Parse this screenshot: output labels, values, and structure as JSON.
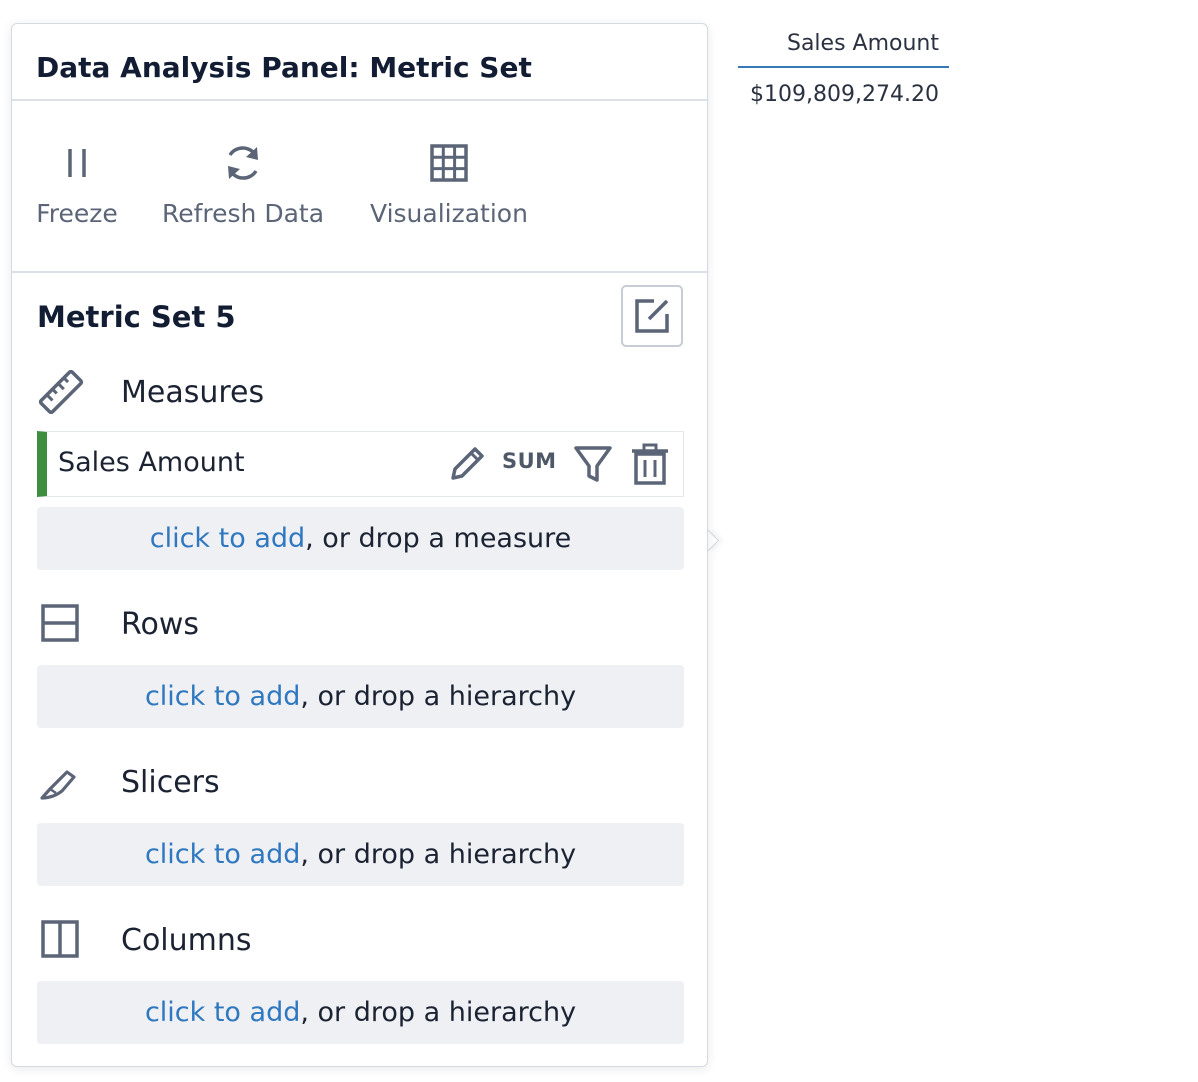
{
  "panel": {
    "title": "Data Analysis Panel: Metric Set"
  },
  "toolbar": {
    "freeze_label": "Freeze",
    "refresh_label": "Refresh Data",
    "visualization_label": "Visualization"
  },
  "metric_set": {
    "title": "Metric Set 5"
  },
  "sections": {
    "measures": {
      "title": "Measures",
      "items": [
        {
          "name": "Sales Amount",
          "aggregation": "SUM"
        }
      ],
      "drop_link": "click to add",
      "drop_text": ", or drop a measure"
    },
    "rows": {
      "title": "Rows",
      "drop_link": "click to add",
      "drop_text": ", or drop a hierarchy"
    },
    "slicers": {
      "title": "Slicers",
      "drop_link": "click to add",
      "drop_text": ", or drop a hierarchy"
    },
    "columns": {
      "title": "Columns",
      "drop_link": "click to add",
      "drop_text": ", or drop a hierarchy"
    }
  },
  "data_grid": {
    "header": "Sales Amount",
    "value": "$109,809,274.20"
  },
  "colors": {
    "measure_accent": "#3e8e3f",
    "link": "#2f78c0",
    "header_underline": "#3778b7"
  },
  "icons": {
    "freeze": "pause-icon",
    "refresh": "refresh-icon",
    "visualization": "grid-table-icon",
    "edit": "edit-square-icon",
    "measures": "ruler-icon",
    "rows": "rows-layout-icon",
    "slicers": "knife-icon",
    "columns": "columns-layout-icon",
    "measure_edit": "pencil-icon",
    "measure_filter": "filter-icon",
    "measure_delete": "trash-icon"
  }
}
